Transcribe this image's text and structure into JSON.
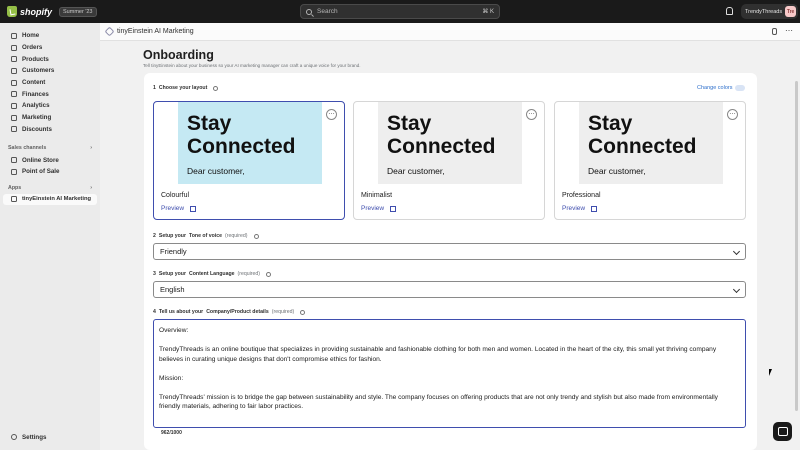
{
  "topbar": {
    "brand": "shopify",
    "edition_badge": "Summer '23",
    "search_placeholder": "Search",
    "search_shortcut": "⌘ K",
    "store_name": "TrendyThreads",
    "avatar_initials": "Tre"
  },
  "sidebar": {
    "items": [
      {
        "label": "Home",
        "icon": "home-icon"
      },
      {
        "label": "Orders",
        "icon": "orders-icon"
      },
      {
        "label": "Products",
        "icon": "products-icon"
      },
      {
        "label": "Customers",
        "icon": "customers-icon"
      },
      {
        "label": "Content",
        "icon": "content-icon"
      },
      {
        "label": "Finances",
        "icon": "finances-icon"
      },
      {
        "label": "Analytics",
        "icon": "analytics-icon"
      },
      {
        "label": "Marketing",
        "icon": "marketing-icon"
      },
      {
        "label": "Discounts",
        "icon": "discounts-icon"
      }
    ],
    "sales_channels_label": "Sales channels",
    "channels": [
      {
        "label": "Online Store"
      },
      {
        "label": "Point of Sale"
      }
    ],
    "apps_label": "Apps",
    "apps": [
      {
        "label": "tinyEinstein AI Marketing"
      }
    ],
    "settings_label": "Settings"
  },
  "app_header": {
    "title": "tinyEinstein AI Marketing"
  },
  "page": {
    "title": "Onboarding",
    "subtitle": "Tell tinyEinstein about your business so your AI marketing manager can craft a unique voice for your brand."
  },
  "step1": {
    "number": "1",
    "label": "Choose your layout",
    "change_colors": "Change colors",
    "templates": [
      {
        "name": "Colourful",
        "preview_label": "Preview",
        "headline1": "Stay",
        "headline2": "Connected",
        "greeting": "Dear customer,",
        "bg": "#c5e9f3",
        "selected": true
      },
      {
        "name": "Minimalist",
        "preview_label": "Preview",
        "headline1": "Stay",
        "headline2": "Connected",
        "greeting": "Dear customer,",
        "bg": "#eeeeee",
        "selected": false
      },
      {
        "name": "Professional",
        "preview_label": "Preview",
        "headline1": "Stay",
        "headline2": "Connected",
        "greeting": "Dear customer,",
        "bg": "#eeeeee",
        "selected": false
      }
    ]
  },
  "step2": {
    "number": "2",
    "prefix": "Setup your",
    "bold": "Tone of voice",
    "required": "(required)",
    "value": "Friendly"
  },
  "step3": {
    "number": "3",
    "prefix": "Setup your",
    "bold": "Content Language",
    "required": "(required)",
    "value": "English"
  },
  "step4": {
    "number": "4",
    "prefix": "Tell us about your",
    "bold": "Company/Product details",
    "required": "(required)",
    "paragraphs": [
      "Overview:",
      "TrendyThreads is an online boutique that specializes in providing sustainable and fashionable clothing for both men and women. Located in the heart of the city, this small yet thriving company believes in curating unique designs that don't compromise ethics for fashion.",
      "Mission:",
      "TrendyThreads' mission is to bridge the gap between sustainability and style. The company focuses on offering products that are not only trendy and stylish but also made from environmentally friendly materials, adhering to fair labor practices."
    ],
    "counter": "962/1000"
  },
  "colors": {
    "accent": "#3f4eae",
    "link": "#2c6ecb",
    "topbar": "#1a1a1a"
  }
}
